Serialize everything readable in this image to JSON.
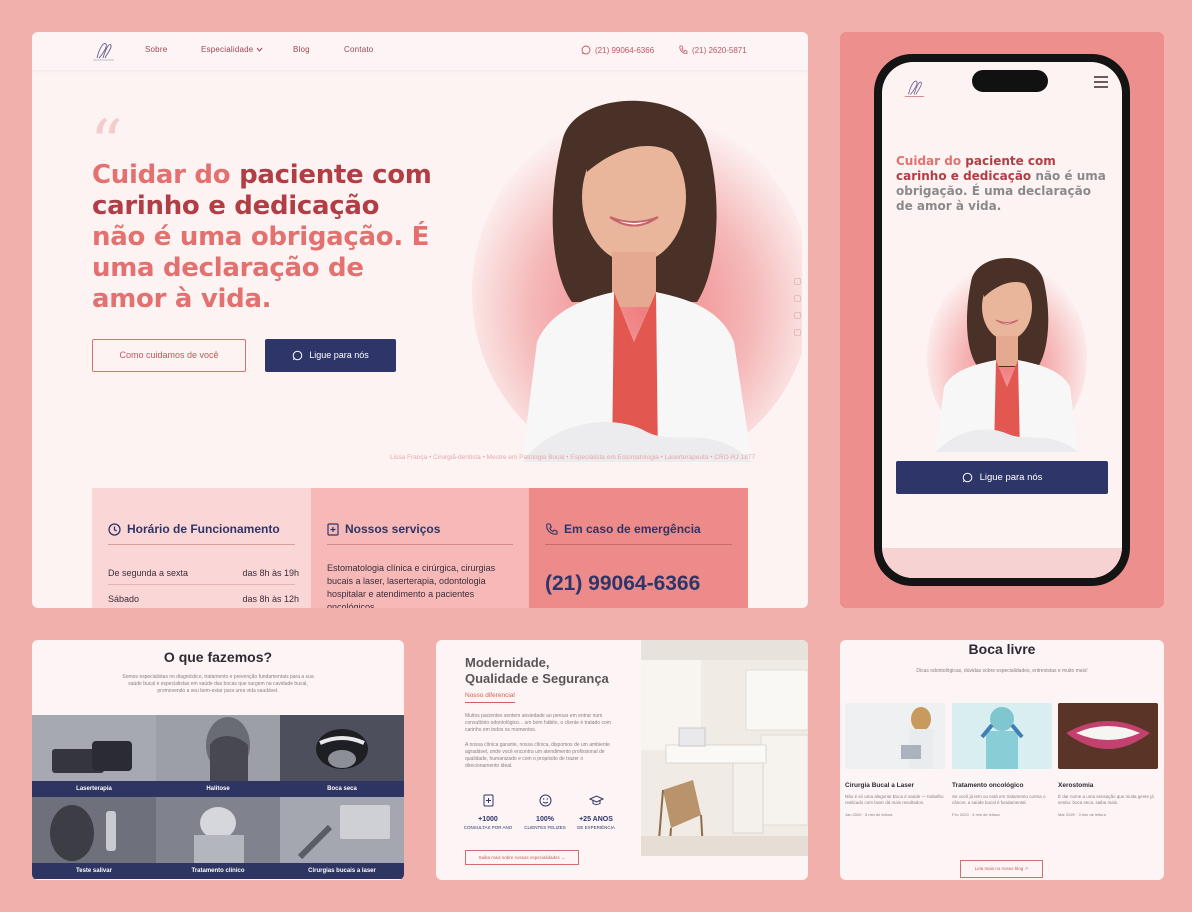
{
  "nav": {
    "links": [
      "Sobre",
      "Especialidade",
      "Blog",
      "Contato"
    ],
    "phone_whatsapp": "(21) 99064-6366",
    "phone_landline": "(21) 2620-5871"
  },
  "hero": {
    "headline_dark_1": "Cuidar do",
    "headline_accent_1": "paciente com carinho e dedicação",
    "headline_rest": "não é uma obrigação. É uma declaração de amor à vida.",
    "button_secondary": "Como cuidamos de você",
    "button_primary": "Ligue para nós",
    "credits": "Lissa França • Cirurgiã-dentista • Mestre em Patologia Bucal • Especialista em Estomatologia • Laserterapeuta • CRO-RJ 1877"
  },
  "info": {
    "hours_title": "Horário de Funcionamento",
    "hours": [
      {
        "day": "De segunda a sexta",
        "time": "das 8h às 19h"
      },
      {
        "day": "Sábado",
        "time": "das 8h às 12h"
      }
    ],
    "services_title": "Nossos serviços",
    "services_text": "Estomatologia clínica e cirúrgica, cirurgias bucais a laser, laserterapia, odontologia hospitalar e atendimento a pacientes oncológicos",
    "emergency_title": "Em caso de emergência",
    "emergency_phone": "(21) 99064-6366"
  },
  "phone_mock": {
    "headline_dark_1": "Cuidar do",
    "headline_accent_1": "paciente com carinho e dedicação",
    "headline_rest": "não é uma obrigação. É uma declaração de amor à vida.",
    "button": "Ligue para nós"
  },
  "services_panel": {
    "title": "O que fazemos?",
    "intro": "Somos especialistas no diagnóstico, tratamento e prevenção fundamentais para a sua saúde bucal e especialistas em saúde das bocas que surgem na cavidade bucal, promovendo a seu bem-estar para uma vida saudável.",
    "tiles": [
      "Laserterapia",
      "Halitose",
      "Boca seca",
      "Teste salivar",
      "Tratamento clínico",
      "Cirurgias bucais a laser"
    ]
  },
  "modern_panel": {
    "title_line1": "Modernidade,",
    "title_line2": "Qualidade e Segurança",
    "subtitle": "Nosso diferencial",
    "paragraph1": "Muitos pacientes sentem ansiedade ao pensar em entrar num consultório odontológico... um bom hábito, o cliente é tratado com carinho em todos os momentos.",
    "paragraph2": "A nossa clínica garante, nossa clínica, dispomos de um ambiente agradável, onde você encontra um atendimento profissional de qualidade, humanizado e com o propósito de trazer o direcionamento ideal.",
    "stats": [
      {
        "value": "+1000",
        "label": "CONSULTAS POR ANO"
      },
      {
        "value": "100%",
        "label": "CLIENTES FELIZES"
      },
      {
        "value": "+25 ANOS",
        "label": "DE EXPERIÊNCIA"
      }
    ],
    "button": "Saiba mais sobre nossas especialidades"
  },
  "blog_panel": {
    "title": "Boca livre",
    "intro": "Dicas odontológicas, dúvidas sobre especialidades, entrevistas e muito mais!",
    "cards": [
      {
        "title": "Cirurgia Bucal a Laser",
        "desc": "Não é só uma alegoria! Boca é saúde — trabalho realizado com laser dá mais resultados.",
        "meta": "Jan 2020 · 5 min de leitura"
      },
      {
        "title": "Tratamento oncológico",
        "desc": "Se você já tem ou está em tratamento contra o câncer, a saúde bucal é fundamental.",
        "meta": "Fev 2020 · 4 min de leitura"
      },
      {
        "title": "Xerostomia",
        "desc": "É dar nome a uma sensação que muita gente já sentiu: boca seca, saiba mais.",
        "meta": "Mar 2020 · 3 min de leitura"
      }
    ],
    "button": "Leia mais no nosso blog"
  },
  "colors": {
    "background": "#f2b0ac",
    "brand_navy": "#2d3569",
    "brand_red": "#b13e44",
    "brand_coral": "#e2716f"
  }
}
